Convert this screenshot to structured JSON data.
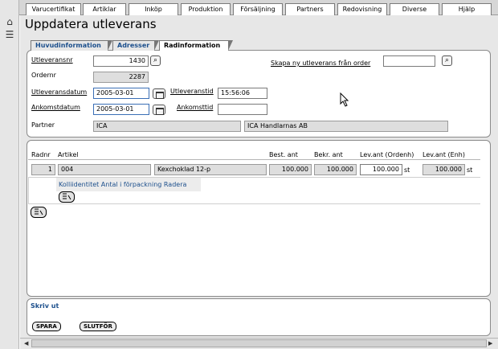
{
  "icons": {
    "home": "home-icon",
    "list": "list-icon",
    "search": "search-icon",
    "calendar": "calendar-icon",
    "cursor": "cursor-icon",
    "edit": "edit-icon"
  },
  "menu": [
    "Varucertifikat",
    "Artiklar",
    "Inköp",
    "Produktion",
    "Försäljning",
    "Partners",
    "Redovisning",
    "Diverse",
    "Hjälp"
  ],
  "page": {
    "title": "Uppdatera utleverans"
  },
  "tabs": [
    "Huvudinformation",
    "Adresser",
    "Radinformation"
  ],
  "form": {
    "utleveransnr": {
      "label": "Utleveransnr",
      "value": "1430"
    },
    "skapa": {
      "label": "Skapa ny utleverans från order",
      "value": ""
    },
    "ordernr": {
      "label": "Ordernr",
      "value": "2287"
    },
    "utleveransdatum": {
      "label": "Utleveransdatum",
      "value": "2005-03-01"
    },
    "utleveranstid": {
      "label": "Utleveranstid",
      "value": "15:56:06"
    },
    "ankomstdatum": {
      "label": "Ankomstdatum",
      "value": "2005-03-01"
    },
    "ankomsttid": {
      "label": "Ankomsttid",
      "value": ""
    },
    "partner": {
      "label": "Partner",
      "code": "ICA",
      "name": "ICA Handlarnas AB"
    }
  },
  "rows": {
    "headers": {
      "radnr": "Radnr",
      "artikel": "Artikel",
      "best": "Best. ant",
      "bekr": "Bekr. ant",
      "levordenh": "Lev.ant (Ordenh)",
      "levenh": "Lev.ant (Enh)"
    },
    "items": [
      {
        "radnr": "1",
        "artikel": "004",
        "benamning": "Kexchoklad 12-p",
        "best": "100.000",
        "bekr": "100.000",
        "lev_ordenh": "100.000",
        "unit1": "st",
        "lev_enh": "100.000",
        "unit2": "st"
      }
    ],
    "sub_links": "Kolliidentitet Antal i förpackning Radera"
  },
  "footer": {
    "print": "Skriv ut",
    "save": "SPARA",
    "finish": "SLUTFÖR"
  }
}
